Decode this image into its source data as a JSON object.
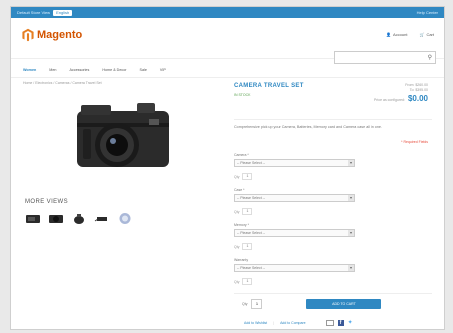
{
  "topbar": {
    "store_label": "Default Store View",
    "store_value": "English",
    "right_text": "Help Center"
  },
  "header": {
    "logo_text": "Magento",
    "account_label": "Account",
    "cart_label": "Cart",
    "search_placeholder": ""
  },
  "nav": [
    "Women",
    "Men",
    "Accessories",
    "Home & Decor",
    "Sale",
    "VIP"
  ],
  "breadcrumb": "Home / Electronics / Cameras / Camera Travel Set",
  "product": {
    "title": "CAMERA TRAVEL SET",
    "stock": "IN STOCK",
    "regular_price_label": "From: $260.00",
    "old_price_label": "To: $395.00",
    "price_label": "Price as configured:",
    "price": "$0.00",
    "description": "Comprehensive pick up your Camera, Batteries, Memory card and Camera case all in one.",
    "required_note": "* Required Fields",
    "more_views": "MORE VIEWS",
    "options": [
      {
        "label": "Camera *",
        "select": "-- Please Select --",
        "qty_label": "Qty",
        "qty": "1"
      },
      {
        "label": "Case *",
        "select": "-- Please Select --",
        "qty_label": "Qty",
        "qty": "1"
      },
      {
        "label": "Memory *",
        "select": "-- Please Select --",
        "qty_label": "Qty",
        "qty": "1"
      },
      {
        "label": "Warranty",
        "select": "-- Please Select --",
        "qty_label": "Qty",
        "qty": "1"
      }
    ],
    "qty_label": "Qty",
    "qty_value": "1",
    "add_to_cart": "ADD TO CART",
    "add_to_wishlist": "Add to Wishlist",
    "add_to_compare": "Add to Compare"
  },
  "colors": {
    "accent": "#2f88c2",
    "logo": "#d35400",
    "stock": "#5aa14f"
  }
}
